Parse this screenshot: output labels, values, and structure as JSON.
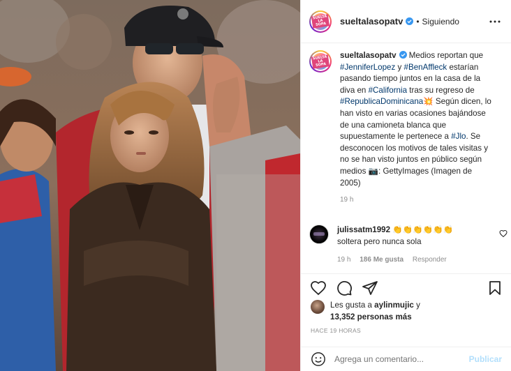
{
  "post": {
    "photo_alt": "",
    "header": {
      "username": "sueltalasopatv",
      "separator": "•",
      "follow_status": "Siguiendo",
      "avatar_text": "SUELTA LA SOPA"
    },
    "caption": {
      "username": "sueltalasopatv",
      "parts": [
        {
          "t": " Medios reportan que ",
          "tag": false
        },
        {
          "t": "#JenniferLopez",
          "tag": true
        },
        {
          "t": " y ",
          "tag": false
        },
        {
          "t": "#BenAffleck",
          "tag": true
        },
        {
          "t": " estarían pasando tiempo juntos en la casa de la diva en ",
          "tag": false
        },
        {
          "t": "#California",
          "tag": true
        },
        {
          "t": " tras su regreso de ",
          "tag": false
        },
        {
          "t": "#RepublicaDominicana",
          "tag": true
        },
        {
          "t": "💥 Según dicen, lo han visto en varias ocasiones bajándose de una camioneta blanca que supuestamente le pertenece a ",
          "tag": false
        },
        {
          "t": "#Jlo",
          "tag": true
        },
        {
          "t": ". Se desconocen los motivos de tales visitas y no se han visto juntos en público según medios 📷: GettyImages (Imagen de 2005)",
          "tag": false
        }
      ],
      "time": "19 h"
    },
    "comment": {
      "username": "julissatm1992",
      "emojis": "👏👏👏👏👏👏",
      "text": "soltera pero nunca sola",
      "time": "19 h",
      "likes": "186 Me gusta",
      "reply": "Responder"
    },
    "likes": {
      "prefix": "Les gusta a ",
      "user": "aylinmujic",
      "middle": " y",
      "count": "13,352 personas más"
    },
    "posted_ago": "HACE 19 HORAS",
    "add_comment": {
      "placeholder": "Agrega un comentario...",
      "publish": "Publicar"
    }
  },
  "colors": {
    "hashtag": "#00376b",
    "muted": "#8e8e8e",
    "publish_disabled": "#b2dffc",
    "verified": "#3897f0"
  },
  "icons": [
    "verified-badge-icon",
    "more-options-icon",
    "heart-icon",
    "comment-icon",
    "share-icon",
    "save-icon",
    "emoji-icon",
    "camera-emoji-icon"
  ]
}
